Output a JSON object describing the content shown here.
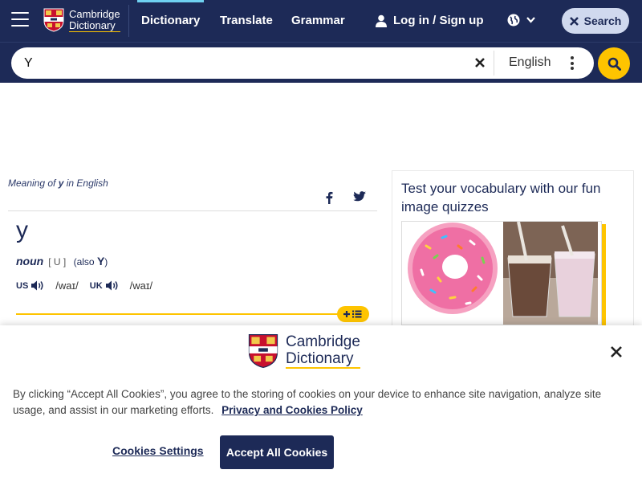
{
  "header": {
    "logo_line1": "Cambridge",
    "logo_line2": "Dictionary",
    "nav": {
      "dictionary": "Dictionary",
      "translate": "Translate",
      "grammar": "Grammar"
    },
    "login": "Log in / Sign up",
    "search_button": "Search"
  },
  "searchbar": {
    "value": "Y",
    "language": "English"
  },
  "entry": {
    "meaning_prefix": "Meaning of ",
    "meaning_word": "y",
    "meaning_suffix": " in English",
    "headword": "y",
    "pos": "noun",
    "grammar": "[ U ]",
    "also_label": "(also",
    "also_word": "Y",
    "also_close": ")",
    "us_label": "US",
    "us_ipa": "/waɪ/",
    "uk_label": "UK",
    "uk_ipa": "/waɪ/"
  },
  "sidebar": {
    "quiz_title": "Test your vocabulary with our fun image quizzes"
  },
  "cookie": {
    "logo_line1": "Cambridge",
    "logo_line2": "Dictionary",
    "text": "By clicking “Accept All Cookies”, you agree to the storing of cookies on your device to enhance site navigation, analyze site usage, and assist in our marketing efforts.",
    "policy_link": "Privacy and Cookies Policy",
    "settings": "Cookies Settings",
    "accept": "Accept All Cookies"
  },
  "colors": {
    "brand_navy": "#1d2a57",
    "accent_yellow": "#fec400",
    "active_tab": "#6fd1f1"
  }
}
